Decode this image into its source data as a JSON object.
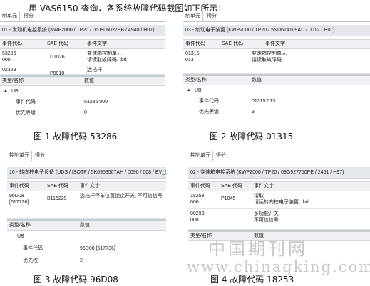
{
  "intro": "用 VAS6150 查询，各系统故障代码截图如下所示：",
  "panels": [
    {
      "tabs": [
        "制单元",
        "得分"
      ],
      "header": "01 - 发动机电控系统  (KWP2000 / TP20 / 06J906027EB  / 4940 / H07)",
      "columns": [
        "事件代码",
        "SAE 代码",
        "事件文字"
      ],
      "rows": [
        {
          "code": "53286\n000",
          "sae": "U1026",
          "text": "变速箱控制单元\n请读取故障码, tbd"
        },
        {
          "code": "02329",
          "sae": "P0010",
          "text": "选档杆"
        }
      ],
      "prop_columns": [
        "类型/名称",
        "数值"
      ],
      "props": [
        {
          "name": "UB",
          "value": ""
        },
        {
          "name": "事件代码",
          "value": "53286 000"
        },
        {
          "name": "优先等级",
          "value": "0"
        }
      ],
      "caption": "图 1    故障代码 53286"
    },
    {
      "tabs": [
        "制单元",
        "得分"
      ],
      "header": "03 - 制动电子装置  (KWP2000 / TP20 / 5ND614109AD / 0012 / H07)",
      "columns": [
        "事件代码",
        "SAE 代码",
        "事件文字"
      ],
      "rows": [
        {
          "code": "01315\n013",
          "sae": "",
          "text": "变速箱控制单元\n请读取故障码"
        }
      ],
      "prop_columns": [
        "类型/名称",
        "数值"
      ],
      "props": [
        {
          "name": "UB",
          "value": ""
        },
        {
          "name": "事件代码",
          "value": "01315 013"
        },
        {
          "name": "优先等级",
          "value": "3"
        }
      ],
      "caption": "图 2    故障代码 01315"
    },
    {
      "tabs": [
        "控制单元",
        "得分"
      ],
      "header": "16 - 转向柱电子设备  (UDS / ISOTP / 5K0953507AH / 0090 / 008 / EV_S",
      "columns": [
        "事件代码",
        "SAE 代码",
        "事件文字"
      ],
      "rows": [
        {
          "code": "96D08\n[617736]",
          "sae": "B116229",
          "text": "选档杆停车位置锁止开关, 不可信信号"
        }
      ],
      "prop_columns": [
        "类型/名称",
        "数值"
      ],
      "props": [
        {
          "name": "UB",
          "value": ""
        },
        {
          "name": "事件代码",
          "value": "96D08 [617736]"
        },
        {
          "name": "优先权",
          "value": "2"
        }
      ],
      "caption": "图 3    故障代码 96D08"
    },
    {
      "tabs": [
        "控制单元",
        "得分"
      ],
      "header": "02 - 变速箱电控系统  (KWP2000 / TP20 / 09G927750PE / 2461 / H97)",
      "columns": [
        "事件代码",
        "SAE 代码",
        "事件文字"
      ],
      "rows": [
        {
          "code": "18253\n000",
          "sae": "P1845",
          "text": "请取\n请读转向柱电子装置, tbd"
        },
        {
          "code": "00293\n008",
          "sae": "",
          "text": "多功能开关\n不可信信号"
        }
      ],
      "prop_columns": [
        "类型/名称",
        "数值"
      ],
      "props": [],
      "caption": "图 4    故障代码 18253"
    }
  ],
  "watermark": {
    "cn": "中国期刊网",
    "url": "www.chinaqking.com"
  }
}
